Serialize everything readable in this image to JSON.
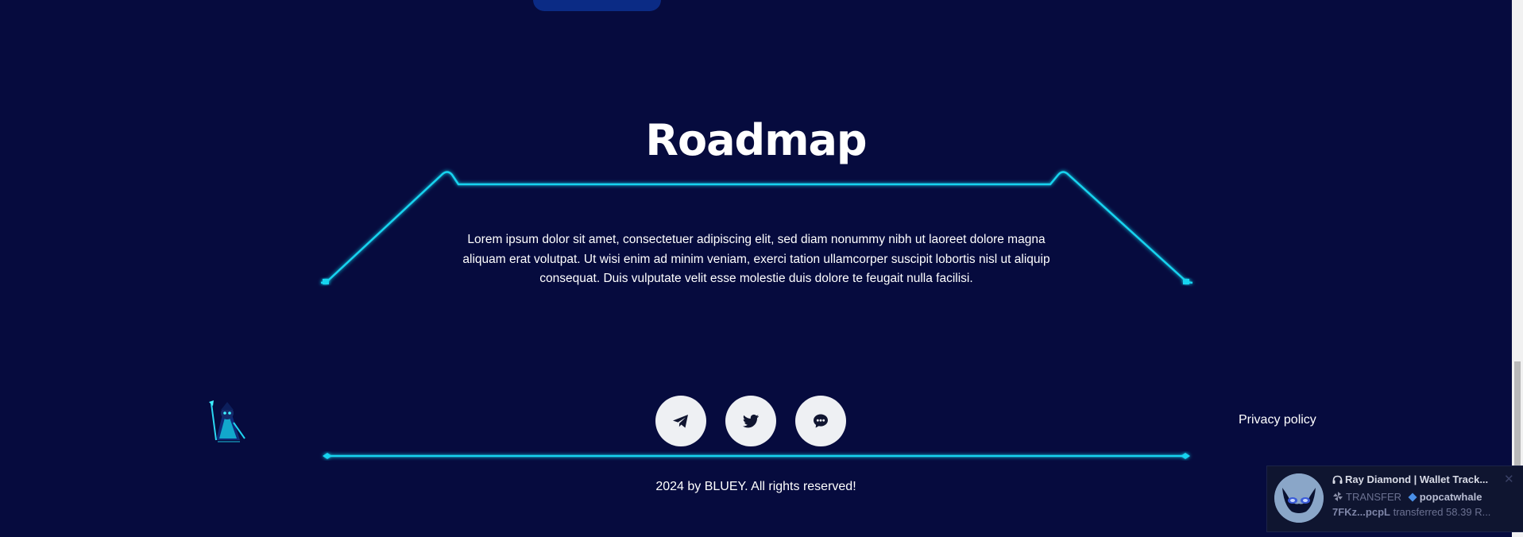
{
  "top_button": {
    "label": ""
  },
  "roadmap": {
    "title": "Roadmap",
    "text": "Lorem ipsum dolor sit amet, consectetuer adipiscing elit, sed diam nonummy nibh ut laoreet dolore magna aliquam erat volutpat. Ut wisi enim ad minim veniam, exerci tation ullamcorper suscipit lobortis nisl ut aliquip consequat. Duis vulputate velit esse molestie duis dolore te feugait nulla facilisi."
  },
  "footer": {
    "logo_icon": "wizard-mascot-icon",
    "socials": [
      {
        "icon": "telegram-icon"
      },
      {
        "icon": "twitter-icon"
      },
      {
        "icon": "chat-bubble-icon"
      }
    ],
    "privacy_label": "Privacy policy",
    "copyright": "2024 by BLUEY. All rights reserved!"
  },
  "toast": {
    "title": "Ray Diamond | Wallet Track...",
    "type_label": "TRANSFER",
    "username": "popcatwhale",
    "address": "7FKz...pcpL",
    "message": "transferred 58.39 R..."
  },
  "colors": {
    "background": "#060b3e",
    "accent_glow": "#19d4f0",
    "social_bg": "#eef0f3",
    "top_button": "#0b2b85"
  }
}
